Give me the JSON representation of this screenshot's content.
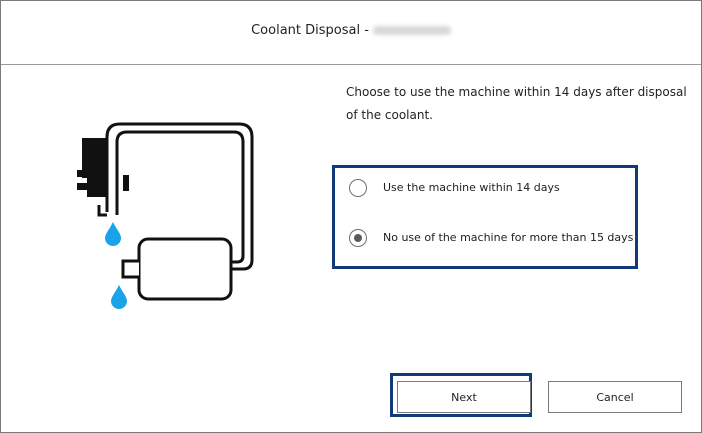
{
  "dialog": {
    "title": "Coolant Disposal -"
  },
  "main": {
    "instruction": "Choose to use the machine within 14 days after disposal of the coolant.",
    "options": [
      {
        "label": "Use the machine within 14 days",
        "selected": false
      },
      {
        "label": "No use of the machine for more than 15 days",
        "selected": true
      }
    ]
  },
  "footer": {
    "next_label": "Next",
    "cancel_label": "Cancel"
  },
  "colors": {
    "focus_border": "#103a78",
    "water_drop": "#1aa3e8"
  },
  "icons": {
    "illustration": "coolant-tank-drain-illustration",
    "drop": "water-drop-icon"
  }
}
